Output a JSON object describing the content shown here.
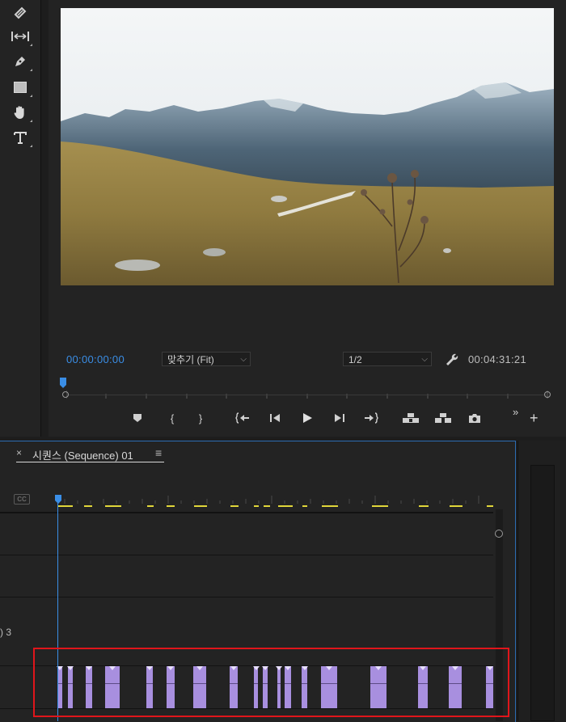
{
  "program_monitor": {
    "current_timecode": "00:00:00:00",
    "zoom_select": "맞추기 (Fit)",
    "resolution_select": "1/2",
    "duration_timecode": "00:04:31:21",
    "viewer_image": "mountain-meadow-landscape"
  },
  "tools": [
    "razor-tool",
    "slip-tool",
    "pen-tool",
    "rectangle-tool",
    "hand-tool",
    "type-tool"
  ],
  "transport_buttons": [
    "add-marker",
    "mark-in",
    "mark-out",
    "go-to-in",
    "step-back",
    "play",
    "step-forward",
    "go-to-out",
    "lift",
    "extract",
    "export-frame",
    "more",
    "add-button"
  ],
  "timeline": {
    "tab_close": "×",
    "sequence_name": "시퀀스 (Sequence) 01",
    "menu_glyph": "≡",
    "cc_label": "CC",
    "track_label_partial": ") 3",
    "highlight_color": "#e0151b",
    "clip_color": "#a88fdf"
  }
}
